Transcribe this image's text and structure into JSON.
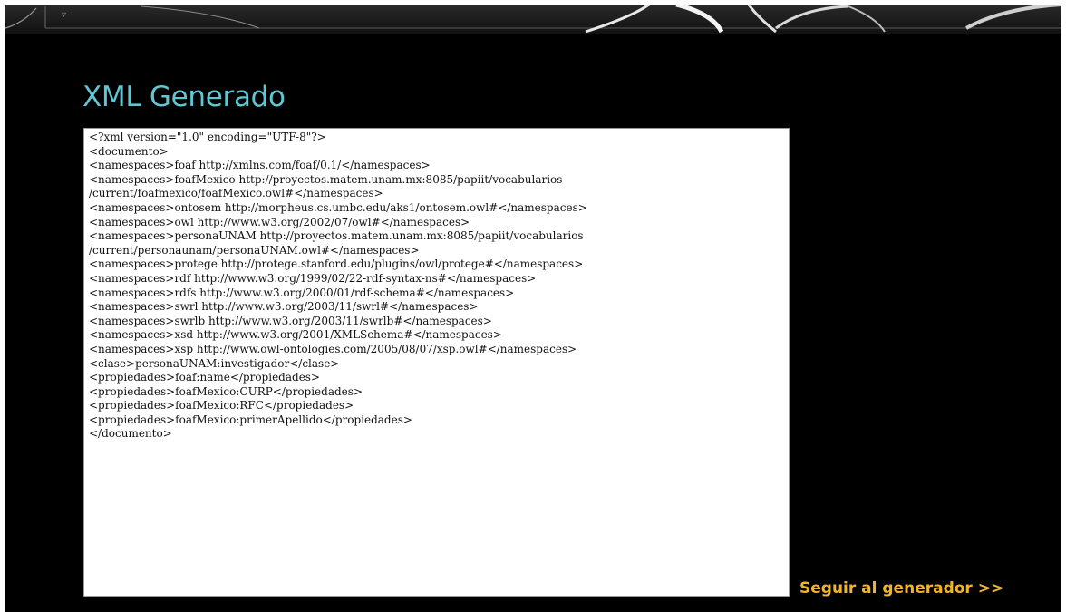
{
  "header": {
    "menu_glyph": "▿"
  },
  "page": {
    "title": "XML Generado"
  },
  "xml": {
    "lines": [
      "<?xml version=\"1.0\" encoding=\"UTF-8\"?>",
      "<documento>",
      "<namespaces>foaf http://xmlns.com/foaf/0.1/</namespaces>",
      "<namespaces>foafMexico http://proyectos.matem.unam.mx:8085/papiit/vocabularios",
      "/current/foafmexico/foafMexico.owl#</namespaces>",
      "<namespaces>ontosem http://morpheus.cs.umbc.edu/aks1/ontosem.owl#</namespaces>",
      "<namespaces>owl http://www.w3.org/2002/07/owl#</namespaces>",
      "<namespaces>personaUNAM http://proyectos.matem.unam.mx:8085/papiit/vocabularios",
      "/current/personaunam/personaUNAM.owl#</namespaces>",
      "<namespaces>protege http://protege.stanford.edu/plugins/owl/protege#</namespaces>",
      "<namespaces>rdf http://www.w3.org/1999/02/22-rdf-syntax-ns#</namespaces>",
      "<namespaces>rdfs http://www.w3.org/2000/01/rdf-schema#</namespaces>",
      "<namespaces>swrl http://www.w3.org/2003/11/swrl#</namespaces>",
      "<namespaces>swrlb http://www.w3.org/2003/11/swrlb#</namespaces>",
      "<namespaces>xsd http://www.w3.org/2001/XMLSchema#</namespaces>",
      "<namespaces>xsp http://www.owl-ontologies.com/2005/08/07/xsp.owl#</namespaces>",
      "<clase>personaUNAM:investigador</clase>",
      "<propiedades>foaf:name</propiedades>",
      "<propiedades>foafMexico:CURP</propiedades>",
      "<propiedades>foafMexico:RFC</propiedades>",
      "<propiedades>foafMexico:primerApellido</propiedades>",
      "</documento>"
    ]
  },
  "actions": {
    "next_label": "Seguir al generador >>"
  },
  "colors": {
    "title": "#5fc7d3",
    "link": "#f2b42b",
    "background": "#000000"
  }
}
